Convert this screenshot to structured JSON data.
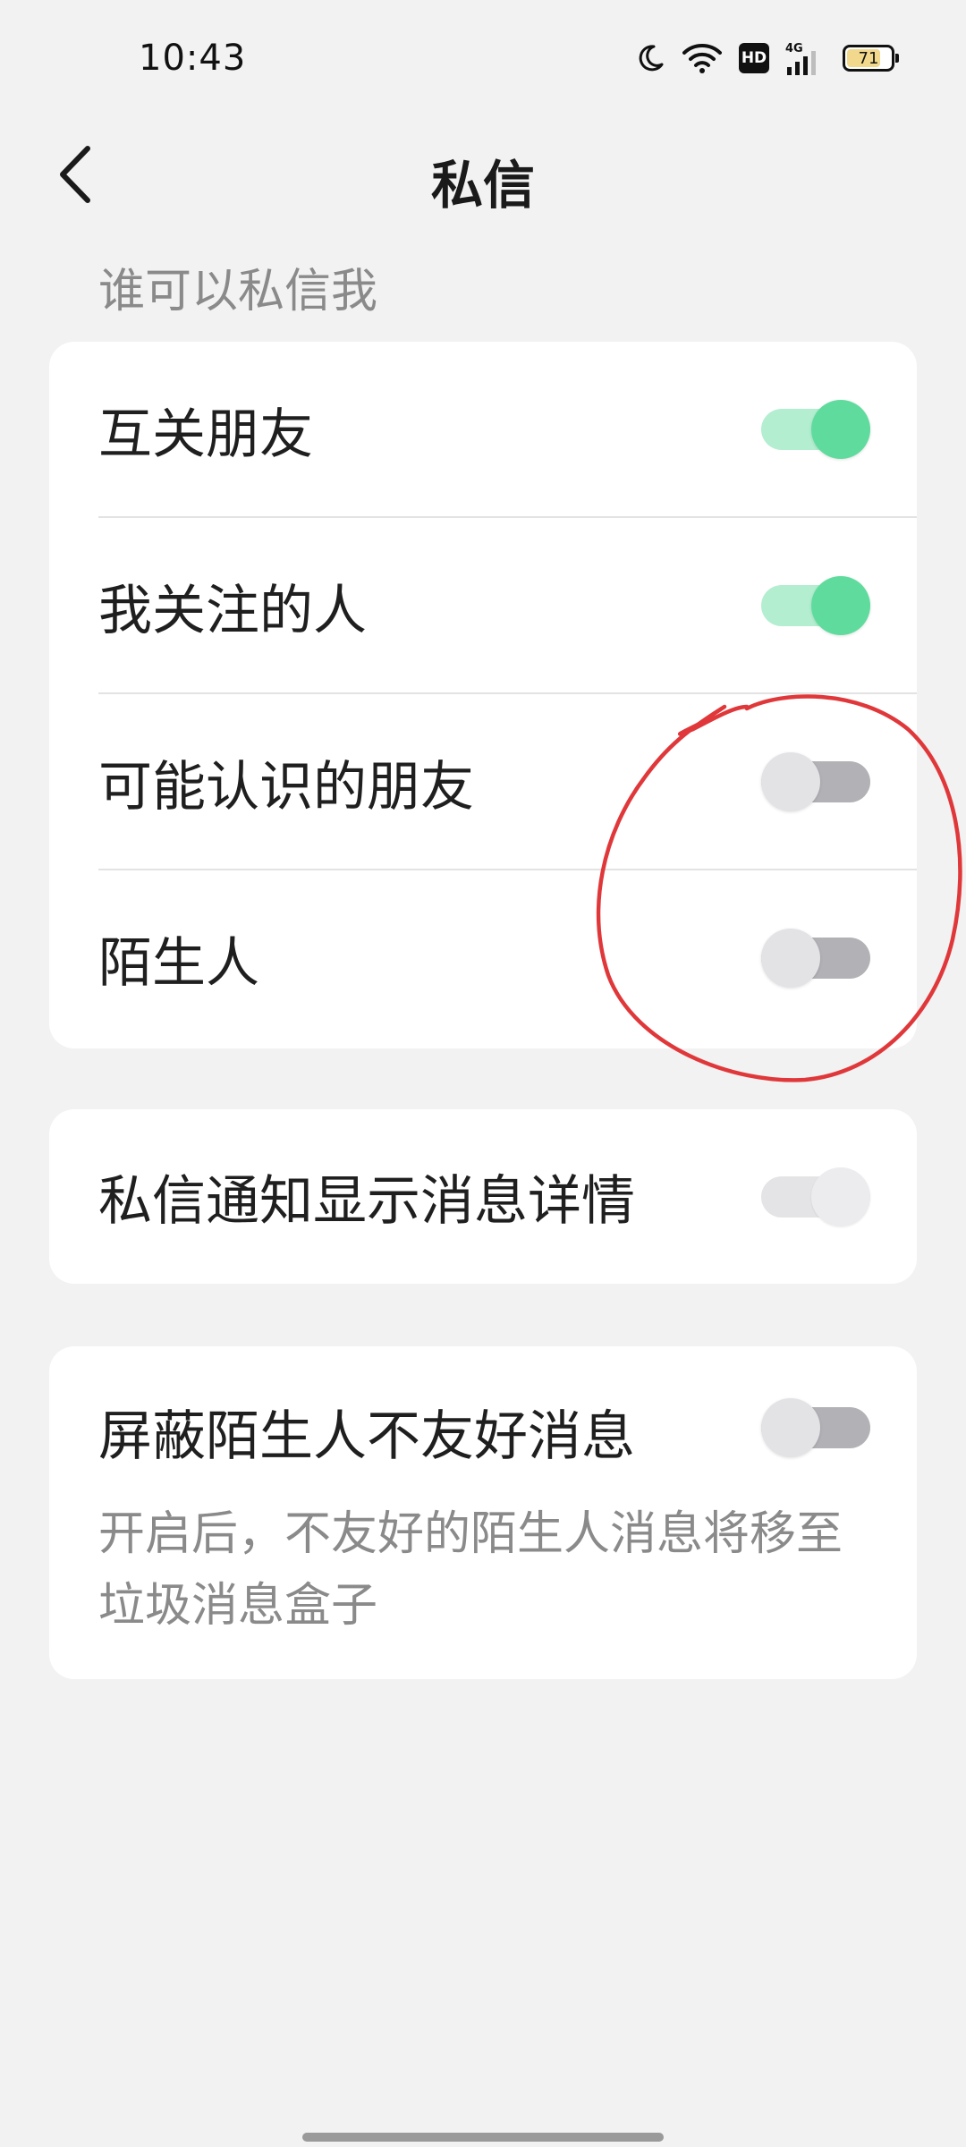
{
  "status_bar": {
    "time": "10:43",
    "network": "4G",
    "hd_label": "HD",
    "battery_level": "71",
    "icons": [
      "moon-icon",
      "wifi-icon",
      "hd-icon",
      "cellular-signal-icon",
      "battery-icon"
    ]
  },
  "header": {
    "title": "私信",
    "back_icon": "chevron-left-icon"
  },
  "section": {
    "title": "谁可以私信我"
  },
  "who_can_message": [
    {
      "label": "互关朋友",
      "enabled": true
    },
    {
      "label": "我关注的人",
      "enabled": true
    },
    {
      "label": "可能认识的朋友",
      "enabled": false
    },
    {
      "label": "陌生人",
      "enabled": false
    }
  ],
  "notification_details": {
    "label": "私信通知显示消息详情",
    "enabled": false
  },
  "block_unfriendly": {
    "label": "屏蔽陌生人不友好消息",
    "description": "开启后，不友好的陌生人消息将移至垃圾消息盒子",
    "enabled": false
  },
  "colors": {
    "toggle_on_knob": "#5fdc9d",
    "toggle_on_track": "#b3eed0",
    "toggle_off_knob": "#e3e3e6",
    "toggle_off_track": "#b1b1b6",
    "annotation": "#e0383a",
    "background": "#f2f2f2"
  }
}
